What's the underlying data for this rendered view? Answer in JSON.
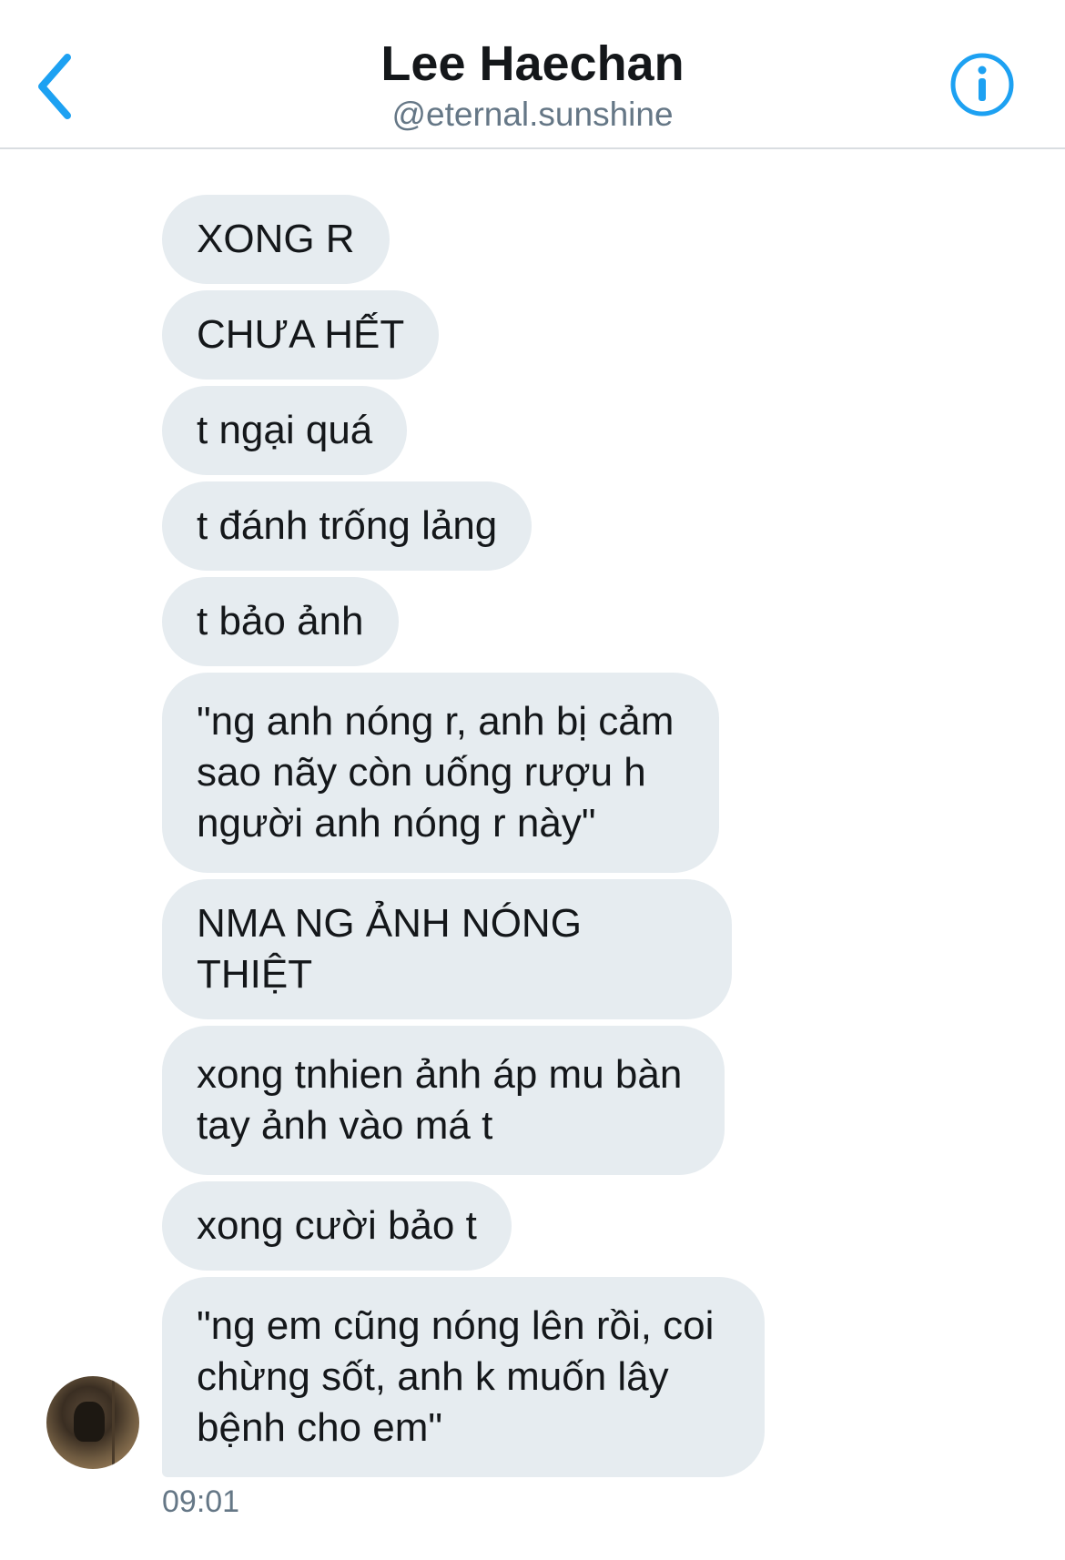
{
  "header": {
    "name": "Lee Haechan",
    "handle": "@eternal.sunshine",
    "back_icon": "chevron-left-icon",
    "info_icon": "info-circle-icon"
  },
  "colors": {
    "accent": "#1da1f2",
    "bubble_bg": "#e6ecf0",
    "text": "#14171a",
    "secondary_text": "#657786"
  },
  "messages": [
    "XONG R",
    "CHƯA HẾT",
    "t ngại quá",
    "t đánh trống lảng",
    "t bảo ảnh",
    "\"ng anh nóng r, anh bị cảm sao nãy còn uống rượu h người anh nóng r này\"",
    "NMA NG ẢNH NÓNG THIỆT",
    "xong tnhien ảnh áp mu bàn tay ảnh vào má t",
    "xong cười bảo t",
    "\"ng em cũng nóng lên rồi, coi chừng sốt, anh k muốn lây bệnh cho em\""
  ],
  "timestamp": "09:01"
}
